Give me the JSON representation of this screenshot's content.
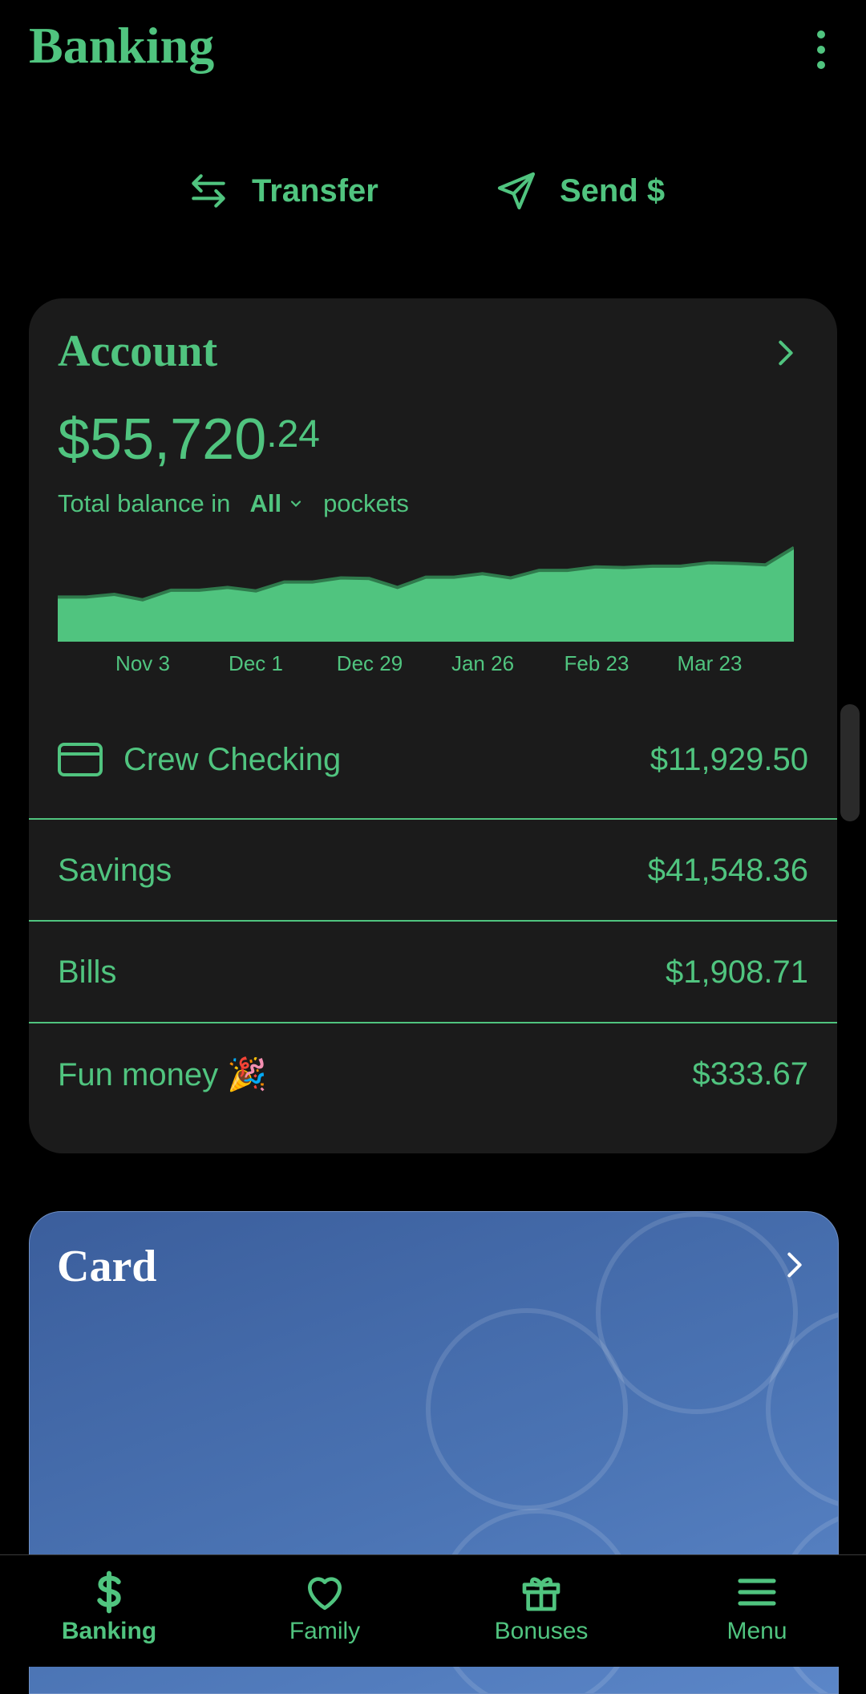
{
  "header": {
    "title": "Banking"
  },
  "actions": {
    "transfer": "Transfer",
    "send": "Send $"
  },
  "account": {
    "title": "Account",
    "balance_whole": "$55,720",
    "balance_cents": ".24",
    "balance_prefix": "Total balance in",
    "pocket_filter": "All",
    "balance_suffix": "pockets",
    "rows": [
      {
        "name": "Crew Checking",
        "amount": "$11,929.50"
      },
      {
        "name": "Savings",
        "amount": "$41,548.36"
      },
      {
        "name": "Bills",
        "amount": "$1,908.71"
      },
      {
        "name": "Fun money 🎉",
        "amount": "$333.67"
      }
    ]
  },
  "chart_data": {
    "type": "area",
    "x_ticks": [
      "Nov 3",
      "Dec 1",
      "Dec 29",
      "Jan 26",
      "Feb 23",
      "Mar 23"
    ],
    "values": [
      48500,
      48500,
      48900,
      48100,
      49500,
      49500,
      49900,
      49400,
      50700,
      50700,
      51300,
      51200,
      49900,
      51400,
      51400,
      51900,
      51300,
      52400,
      52400,
      52900,
      52800,
      53000,
      53000,
      53500,
      53400,
      53200,
      55720
    ],
    "color": "#50c47f"
  },
  "card": {
    "title": "Card"
  },
  "nav": {
    "items": [
      {
        "label": "Banking",
        "icon": "dollar-icon"
      },
      {
        "label": "Family",
        "icon": "heart-icon"
      },
      {
        "label": "Bonuses",
        "icon": "gift-icon"
      },
      {
        "label": "Menu",
        "icon": "menu-icon"
      }
    ]
  },
  "colors": {
    "accent": "#50c47f",
    "card_bg": "#1b1b1b",
    "card_blue": "#4a73b3"
  }
}
